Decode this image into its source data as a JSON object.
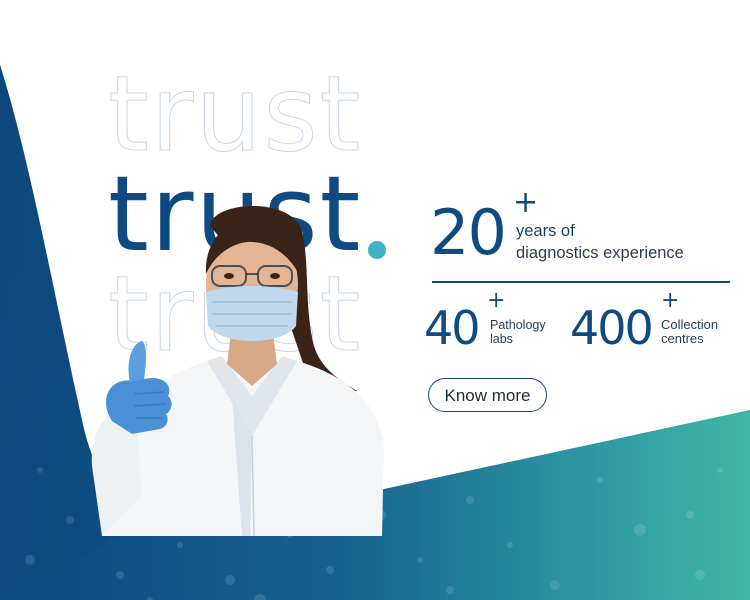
{
  "hero": {
    "word_top": "trust",
    "word_main": "trust",
    "word_bottom": "trust"
  },
  "stats": {
    "years": {
      "number": "20",
      "plus": "+",
      "caption_line1": "years of",
      "caption_line2": "diagnostics experience"
    },
    "labs": {
      "number": "40",
      "plus": "+",
      "caption_line1": "Pathology",
      "caption_line2": "labs"
    },
    "centres": {
      "number": "400",
      "plus": "+",
      "caption_line1": "Collection",
      "caption_line2": "centres"
    }
  },
  "cta": {
    "label": "Know more"
  },
  "colors": {
    "brand_navy": "#0f4a82",
    "accent_teal": "#3fb2c6",
    "gradient_teal": "#3fb3a8"
  },
  "image": {
    "subject": "doctor-in-mask-thumbs-up"
  }
}
